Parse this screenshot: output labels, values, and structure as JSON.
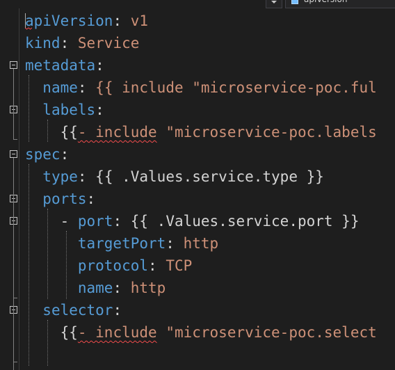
{
  "toolbar": {
    "symbol_label": "apiVersion",
    "symbol_icon": "property-icon",
    "dropdown_icon": "chevron-down-icon"
  },
  "colors": {
    "background": "#1e1e1e",
    "key": "#569cd6",
    "string": "#ce9178",
    "plain": "#d4d4d4",
    "error_squiggle": "#f14c4c"
  },
  "code": {
    "lines": [
      {
        "key": "apiVersion",
        "sep": ": ",
        "value": "v1"
      },
      {
        "key": "kind",
        "sep": ": ",
        "value": "Service"
      },
      {
        "key": "metadata",
        "sep": ":",
        "value": ""
      },
      {
        "key": "name",
        "sep": ": ",
        "value": "{{ include \"microservice-poc.ful"
      },
      {
        "key": "labels",
        "sep": ":",
        "value": ""
      },
      {
        "pre": "{{",
        "err": "- include",
        "rest": " \"microservice-poc.labels"
      },
      {
        "key": "spec",
        "sep": ":",
        "value": ""
      },
      {
        "key": "type",
        "sep": ": ",
        "value": "{{ .Values.service.type }}"
      },
      {
        "key": "ports",
        "sep": ":",
        "value": ""
      },
      {
        "dash": "- ",
        "key": "port",
        "sep": ": ",
        "value": "{{ .Values.service.port }}"
      },
      {
        "key": "targetPort",
        "sep": ": ",
        "value": "http"
      },
      {
        "key": "protocol",
        "sep": ": ",
        "value": "TCP"
      },
      {
        "key": "name",
        "sep": ": ",
        "value": "http"
      },
      {
        "key": "selector",
        "sep": ":",
        "value": ""
      },
      {
        "pre": "{{",
        "err": "- include",
        "rest": " \"microservice-poc.select"
      }
    ]
  }
}
